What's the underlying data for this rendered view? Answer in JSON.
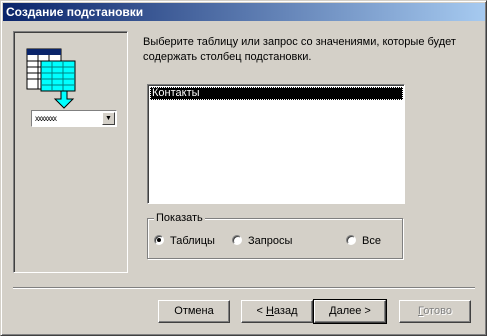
{
  "window": {
    "title": "Создание подстановки"
  },
  "illustration": {
    "combo_sample": "xxxxxxx"
  },
  "prompt": {
    "line1": "Выберите таблицу или запрос со значениями, которые будет",
    "line2": "содержать столбец подстановки."
  },
  "list": {
    "items": [
      "Контакты"
    ],
    "selected": "Контакты"
  },
  "show_group": {
    "legend": "Показать",
    "options": [
      {
        "label": "Таблицы",
        "checked": true
      },
      {
        "label": "Запросы",
        "checked": false
      },
      {
        "label": "Все",
        "checked": false
      }
    ]
  },
  "buttons": {
    "cancel": "Отмена",
    "back_prefix": "< ",
    "back_accel": "Н",
    "back_rest": "азад",
    "next_accel": "Д",
    "next_rest": "алее >",
    "finish_accel": "Г",
    "finish_rest": "отово"
  }
}
